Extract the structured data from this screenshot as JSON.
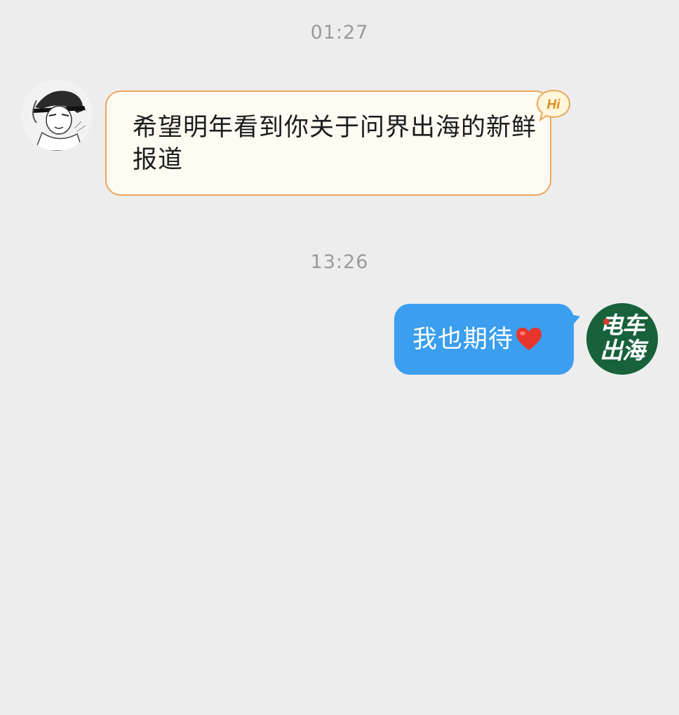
{
  "conversation": {
    "messages": [
      {
        "timestamp": "01:27",
        "direction": "incoming",
        "text": "希望明年看到你关于问界出海的新鲜报道",
        "badge": "Hi"
      },
      {
        "timestamp": "13:26",
        "direction": "outgoing",
        "text": "我也期待",
        "emoji": "red-heart-icon"
      }
    ],
    "right_avatar_logo": {
      "line1": "电车",
      "line2": "出海"
    }
  },
  "colors": {
    "background": "#ededed",
    "incoming_bubble": "#fdfbf2",
    "incoming_border": "#e9a75a",
    "outgoing_bubble": "#3b9eef",
    "logo_avatar": "#17613b",
    "timestamp_text": "#9a9a9a"
  }
}
